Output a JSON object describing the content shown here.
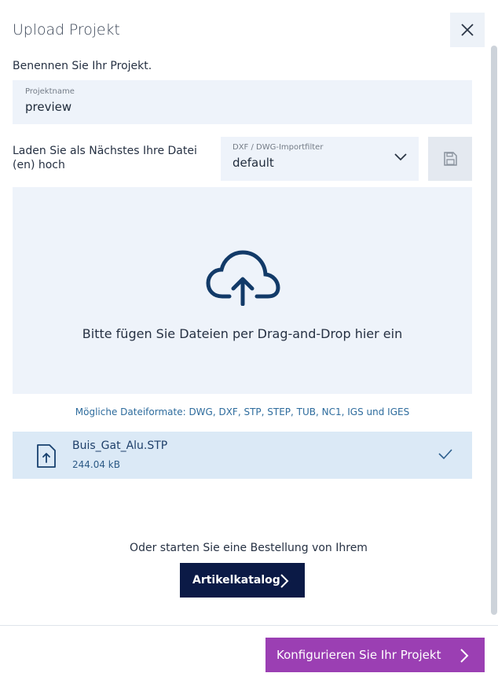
{
  "dialog": {
    "title": "Upload Projekt"
  },
  "project": {
    "prompt": "Benennen Sie Ihr Projekt.",
    "name_label": "Projektname",
    "name_value": "preview"
  },
  "upload": {
    "prompt": "Laden Sie als Nächstes Ihre Datei (en) hoch",
    "filter_label": "DXF / DWG-Importfilter",
    "filter_value": "default",
    "dropzone_text": "Bitte fügen Sie Dateien per Drag-and-Drop hier ein",
    "formats_text": "Mögliche Dateiformate: DWG, DXF, STP, STEP, TUB, NC1, IGS und IGES"
  },
  "files": [
    {
      "name": "Buis_Gat_Alu.STP",
      "size": "244.04 kB",
      "status": "check-icon"
    }
  ],
  "order": {
    "text": "Oder starten Sie eine Bestellung von Ihrem",
    "catalog_label": "Artikelkatalog"
  },
  "footer": {
    "configure_label": "Konfigurieren Sie Ihr Projekt"
  },
  "colors": {
    "accent_purple": "#9b3fb3",
    "navy": "#0b1a46",
    "field_bg": "#eef3fa",
    "file_row_bg": "#dbe9f6"
  }
}
